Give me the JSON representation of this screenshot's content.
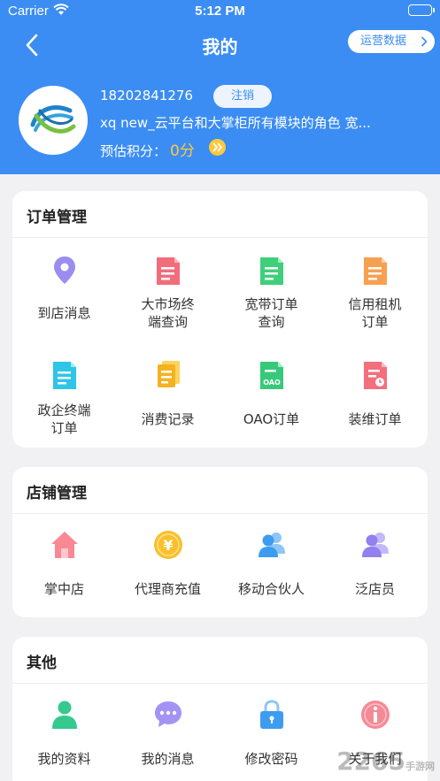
{
  "status_bar": {
    "carrier": "Carrier",
    "time": "5:12 PM"
  },
  "nav": {
    "title": "我的",
    "ops_button": "运营数据"
  },
  "profile": {
    "phone": "18202841276",
    "logout_label": "注销",
    "roles": "xq  new_云平台和大掌柜所有模块的角色  宽...",
    "points_label": "预估积分：",
    "points_value": "0分"
  },
  "orders": {
    "title": "订单管理",
    "items": [
      {
        "label_line1": "到店消息",
        "label_line2": "",
        "icon": "location-pin-icon"
      },
      {
        "label_line1": "大市场终",
        "label_line2": "端查询",
        "icon": "document-icon"
      },
      {
        "label_line1": "宽带订单",
        "label_line2": "查询",
        "icon": "document-icon"
      },
      {
        "label_line1": "信用租机",
        "label_line2": "订单",
        "icon": "document-icon"
      },
      {
        "label_line1": "政企终端",
        "label_line2": "订单",
        "icon": "document-icon"
      },
      {
        "label_line1": "消费记录",
        "label_line2": "",
        "icon": "stacked-documents-icon"
      },
      {
        "label_line1": "OAO订单",
        "label_line2": "",
        "icon": "oao-document-icon"
      },
      {
        "label_line1": "装维订单",
        "label_line2": "",
        "icon": "document-clock-icon"
      }
    ]
  },
  "store": {
    "title": "店铺管理",
    "items": [
      {
        "label_line1": "掌中店",
        "icon": "house-icon"
      },
      {
        "label_line1": "代理商充值",
        "icon": "yuan-coin-icon"
      },
      {
        "label_line1": "移动合伙人",
        "icon": "people-icon"
      },
      {
        "label_line1": "泛店员",
        "icon": "people-icon"
      }
    ]
  },
  "other": {
    "title": "其他",
    "items": [
      {
        "label_line1": "我的资料",
        "icon": "person-icon"
      },
      {
        "label_line1": "我的消息",
        "icon": "chat-bubble-icon"
      },
      {
        "label_line1": "修改密码",
        "icon": "lock-icon"
      },
      {
        "label_line1": "关于我们",
        "icon": "info-icon"
      }
    ]
  },
  "watermark": {
    "text": "2265",
    "sub": "手游网"
  },
  "colors": {
    "brand": "#3b8df3",
    "points": "#ffc93a",
    "background": "#f1f1f3"
  }
}
